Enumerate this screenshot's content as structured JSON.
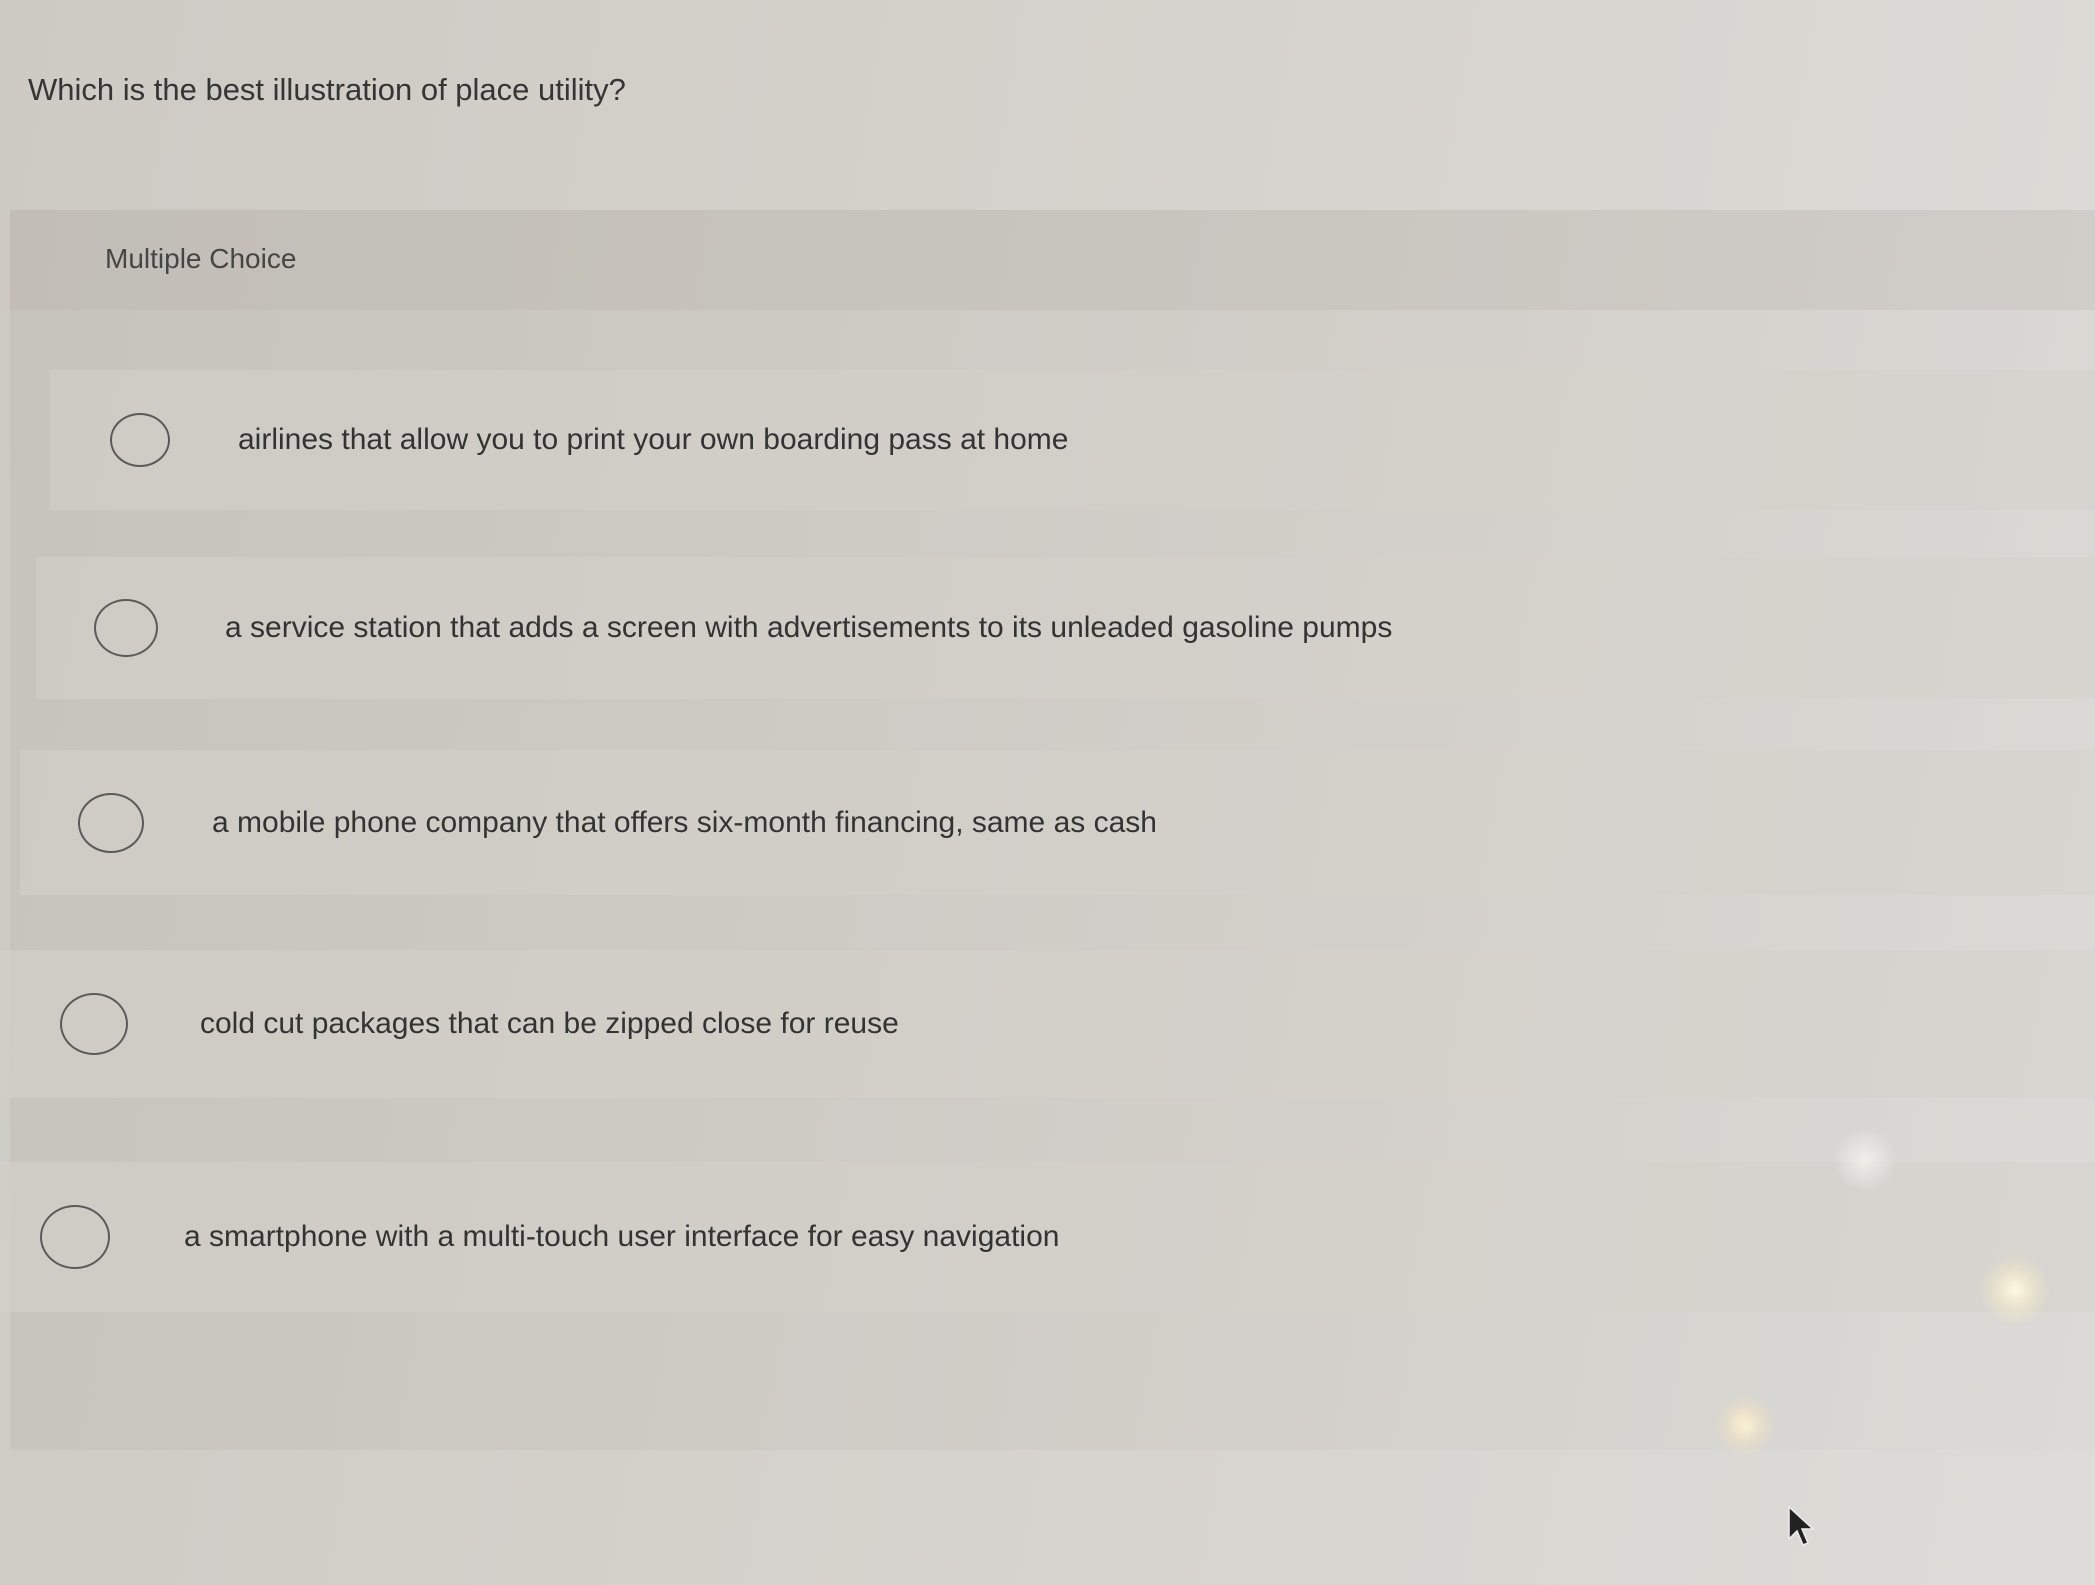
{
  "question": {
    "text": "Which is the best illustration of place utility?"
  },
  "multiple_choice": {
    "label": "Multiple Choice",
    "options": [
      {
        "label": "airlines that allow you to print your own boarding pass at home",
        "selected": false
      },
      {
        "label": "a service station that adds a screen with advertisements to its unleaded gasoline pumps",
        "selected": false
      },
      {
        "label": "a mobile phone company that offers six-month financing, same as cash",
        "selected": false
      },
      {
        "label": "cold cut packages that can be zipped close for reuse",
        "selected": false
      },
      {
        "label": "a smartphone with a multi-touch user interface for easy navigation",
        "selected": false
      }
    ]
  },
  "icons": {
    "radio": "radio-button-unselected-icon",
    "cursor": "mouse-pointer-icon"
  }
}
